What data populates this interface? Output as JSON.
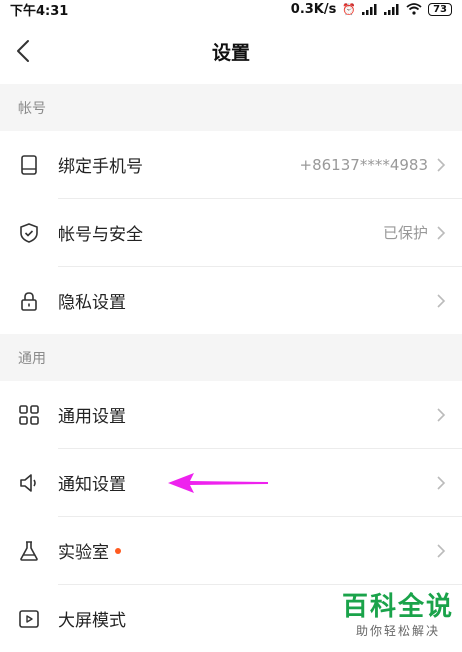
{
  "statusbar": {
    "time": "下午4:31",
    "speed": "0.3K/s",
    "battery": "73"
  },
  "header": {
    "title": "设置"
  },
  "sections": {
    "account": "帐号",
    "general": "通用"
  },
  "rows": {
    "bind_phone": {
      "label": "绑定手机号",
      "value": "+86137****4983"
    },
    "account_security": {
      "label": "帐号与安全",
      "value": "已保护"
    },
    "privacy": {
      "label": "隐私设置"
    },
    "general_settings": {
      "label": "通用设置"
    },
    "notification": {
      "label": "通知设置"
    },
    "lab": {
      "label": "实验室"
    },
    "big_screen": {
      "label": "大屏模式"
    }
  },
  "watermark": {
    "title": "百科全说",
    "subtitle": "助你轻松解决"
  },
  "colors": {
    "accent_arrow": "#ee22ee",
    "badge_dot": "#ff5a1f",
    "watermark_green": "#1aa34a",
    "section_bg": "#f5f5f5"
  }
}
